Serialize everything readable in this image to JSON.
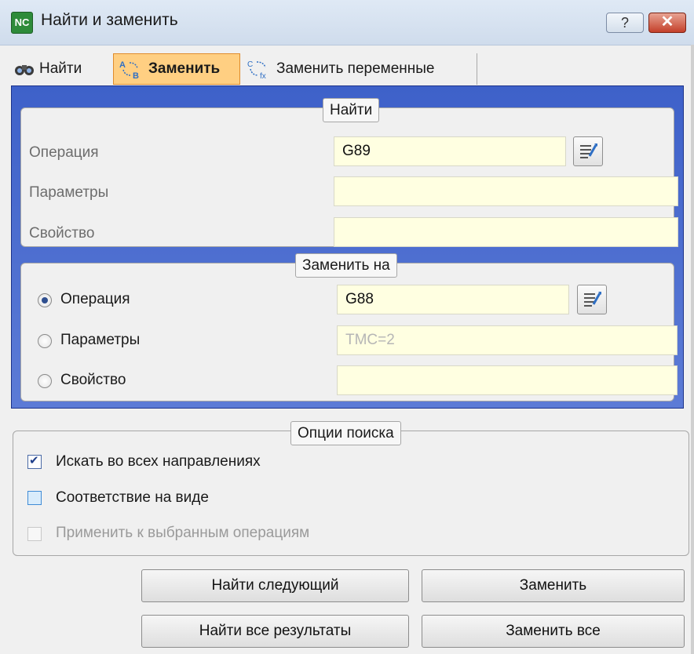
{
  "window": {
    "title": "Найти и заменить",
    "app_icon": "find-replace-app-icon",
    "help_label": "?",
    "close_label": "✕"
  },
  "tabs": [
    {
      "label": "Найти",
      "icon": "binoculars-icon",
      "selected": false
    },
    {
      "label": "Заменить",
      "icon": "replace-ab-icon",
      "selected": true
    },
    {
      "label": "Заменить переменные",
      "icon": "replace-variables-icon",
      "selected": false
    }
  ],
  "find_group": {
    "title": "Найти",
    "operation_label": "Операция",
    "operation_value": "G89",
    "parameters_label": "Параметры",
    "parameters_value": "",
    "property_label": "Свойство",
    "property_value": ""
  },
  "replace_group": {
    "title": "Заменить на",
    "operation_label": "Операция",
    "operation_value": "G88",
    "operation_selected": true,
    "parameters_label": "Параметры",
    "parameters_value": "TMC=2",
    "property_label": "Свойство",
    "property_value": ""
  },
  "options_group": {
    "title": "Опции поиска",
    "search_all_directions": {
      "label": "Искать во всех направлениях",
      "checked": true
    },
    "match_on_view": {
      "label": "Соответствие на виде",
      "checked": false
    },
    "apply_to_selected": {
      "label": "Применить к выбранным операциям",
      "checked": false,
      "enabled": false
    }
  },
  "buttons": {
    "find_next": "Найти следующий",
    "replace": "Заменить",
    "find_all": "Найти все результаты",
    "replace_all": "Заменить все"
  },
  "colors": {
    "selected_tab": "#ffcf82",
    "tab_panel_border": "#3e61c9",
    "input_background": "#ffffe1"
  }
}
